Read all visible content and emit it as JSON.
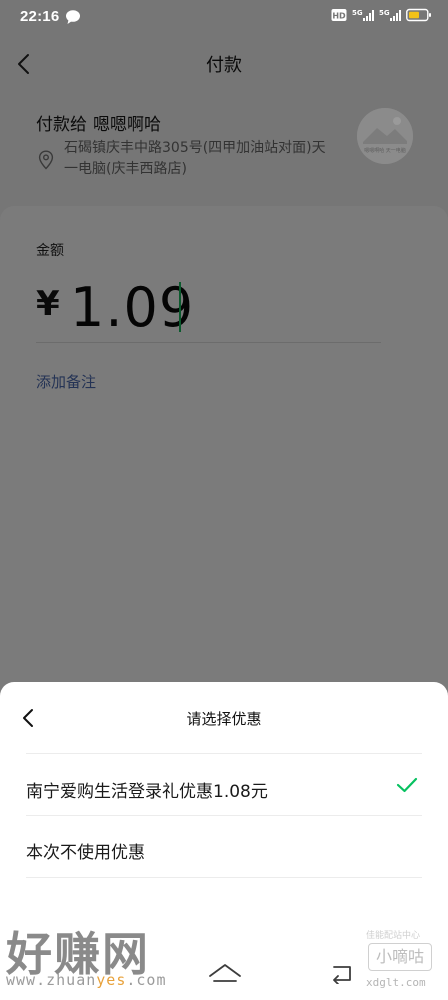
{
  "status_bar": {
    "time": "22:16",
    "network_1": "5G",
    "network_2": "5G",
    "hd_badge": "HD"
  },
  "header": {
    "title": "付款"
  },
  "merchant": {
    "prefix": "付款给",
    "name": "嗯嗯啊哈",
    "address": "石碣镇庆丰中路305号(四甲加油站对面)天一电脑(庆丰西路店)",
    "avatar_caption": "嗯嗯啊哈 天一电脑"
  },
  "payment": {
    "amount_label": "金额",
    "currency_symbol": "¥",
    "amount": "1.09",
    "add_remark": "添加备注"
  },
  "discount_sheet": {
    "title": "请选择优惠",
    "options": [
      {
        "label": "南宁爱购生活登录礼优惠1.08元",
        "selected": true
      },
      {
        "label": "本次不使用优惠",
        "selected": false
      }
    ]
  },
  "watermark": {
    "main_text": "好赚网",
    "url_prefix": "www.zhuan",
    "url_accent": "yes",
    "url_suffix": ".com",
    "right_top_text": "佳能配站中心",
    "right_brand": "小嘀咕",
    "right_url": "xdglt.com"
  },
  "colors": {
    "overlay_bg": "#767676",
    "accent_green": "#07c160",
    "link_blue": "#243355"
  }
}
